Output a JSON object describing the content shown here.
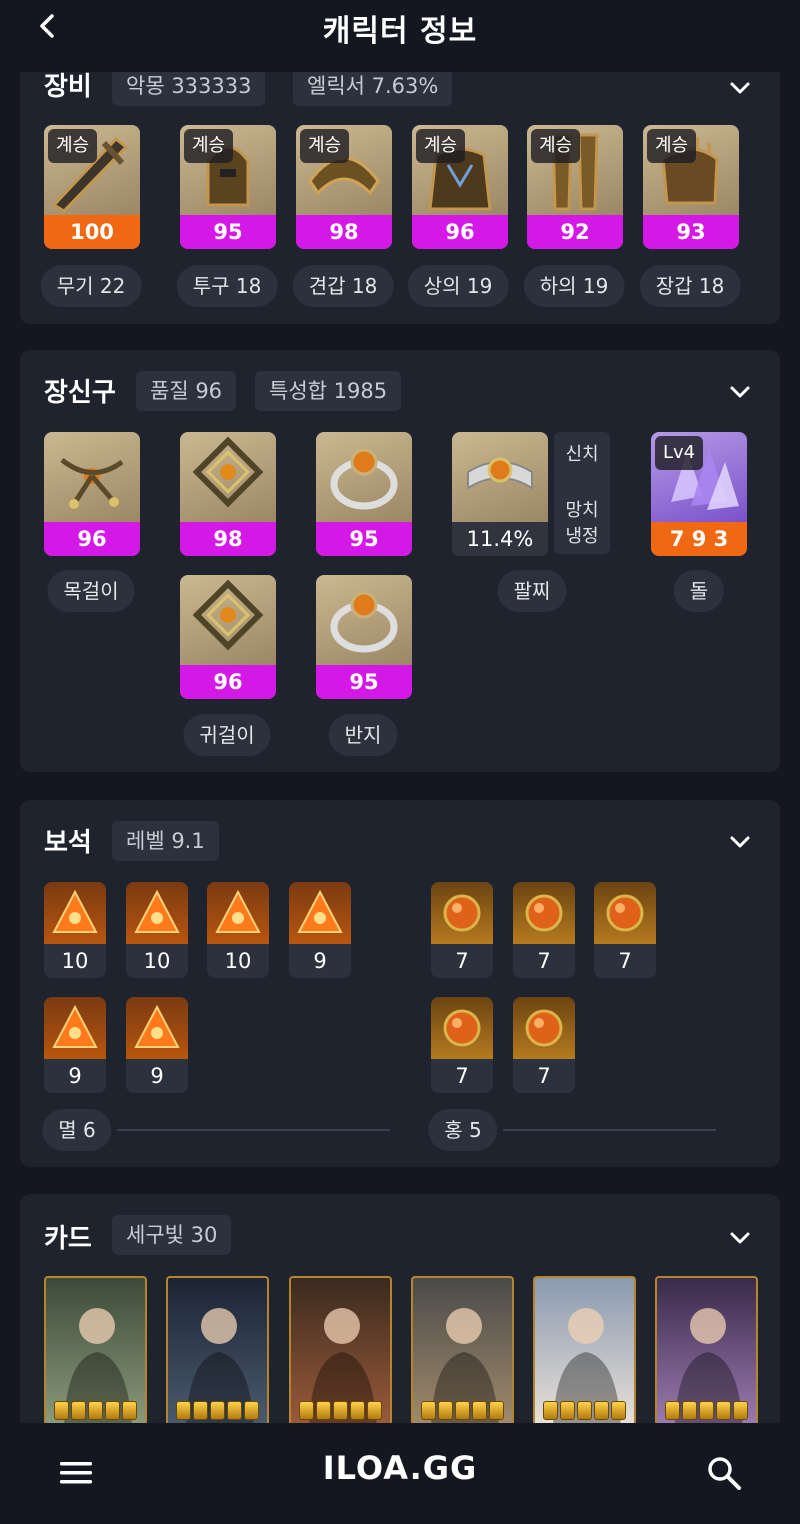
{
  "header": {
    "title": "캐릭터 정보"
  },
  "equipment": {
    "title": "장비",
    "chips": [
      "악몽 333333",
      "엘릭서 7.63%"
    ],
    "items": [
      {
        "tag": "계승",
        "quality": "100",
        "label": "무기 22",
        "color": "orange"
      },
      {
        "tag": "계승",
        "quality": "95",
        "label": "투구 18",
        "color": "magenta"
      },
      {
        "tag": "계승",
        "quality": "98",
        "label": "견갑 18",
        "color": "magenta"
      },
      {
        "tag": "계승",
        "quality": "96",
        "label": "상의 19",
        "color": "magenta"
      },
      {
        "tag": "계승",
        "quality": "92",
        "label": "하의 19",
        "color": "magenta"
      },
      {
        "tag": "계승",
        "quality": "93",
        "label": "장갑 18",
        "color": "magenta"
      }
    ]
  },
  "accessories": {
    "title": "장신구",
    "chips": [
      "품질 96",
      "특성합 1985"
    ],
    "necklace": {
      "quality": "96",
      "label": "목걸이"
    },
    "earrings": [
      {
        "quality": "98"
      },
      {
        "quality": "96"
      }
    ],
    "earring_label": "귀걸이",
    "rings": [
      {
        "quality": "95"
      },
      {
        "quality": "95"
      }
    ],
    "ring_label": "반지",
    "bracelet": {
      "value": "11.4%",
      "label": "팔찌",
      "effects": [
        "신치",
        "망치",
        "냉정"
      ]
    },
    "stone": {
      "level": "Lv4",
      "value": "7 9 3",
      "label": "돌"
    }
  },
  "gems": {
    "title": "보석",
    "chip": "레벨 9.1",
    "left_levels": [
      "10",
      "10",
      "10",
      "9",
      "9",
      "9"
    ],
    "right_levels": [
      "7",
      "7",
      "7",
      "7",
      "7"
    ],
    "left_summary": "멸 6",
    "right_summary": "홍 5"
  },
  "cards": {
    "title": "카드",
    "chip": "세구빛 30",
    "count": 6
  },
  "footer": {
    "logo": "ILOA.GG"
  }
}
